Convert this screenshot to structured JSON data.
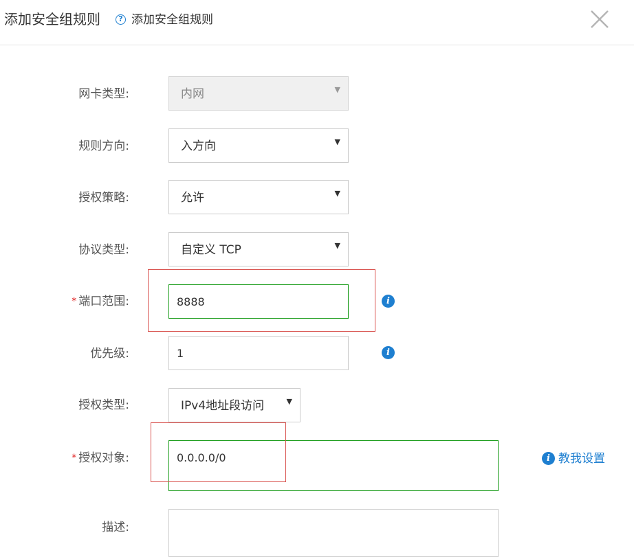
{
  "dialog": {
    "title": "添加安全组规则",
    "subtitle": "添加安全组规则",
    "help_glyph": "?",
    "close_icon": "close-icon"
  },
  "form": {
    "nic_type": {
      "label": "网卡类型:",
      "value": "内网",
      "disabled": true
    },
    "direction": {
      "label": "规则方向:",
      "value": "入方向"
    },
    "policy": {
      "label": "授权策略:",
      "value": "允许"
    },
    "protocol": {
      "label": "协议类型:",
      "value": "自定义 TCP"
    },
    "port_range": {
      "label": "端口范围:",
      "value": "8888",
      "required_mark": "*"
    },
    "priority": {
      "label": "优先级:",
      "value": "1"
    },
    "auth_type": {
      "label": "授权类型:",
      "value": "IPv4地址段访问"
    },
    "auth_object": {
      "label": "授权对象:",
      "value": "0.0.0.0/0",
      "required_mark": "*",
      "help_link": "教我设置"
    },
    "description": {
      "label": "描述:",
      "value": ""
    }
  },
  "icons": {
    "info_glyph": "i",
    "dropdown_glyph": "▼"
  },
  "colors": {
    "accent": "#1e7fd0",
    "valid_border": "#1a9c1a",
    "required": "#e02020",
    "annotation": "#d9534f"
  }
}
